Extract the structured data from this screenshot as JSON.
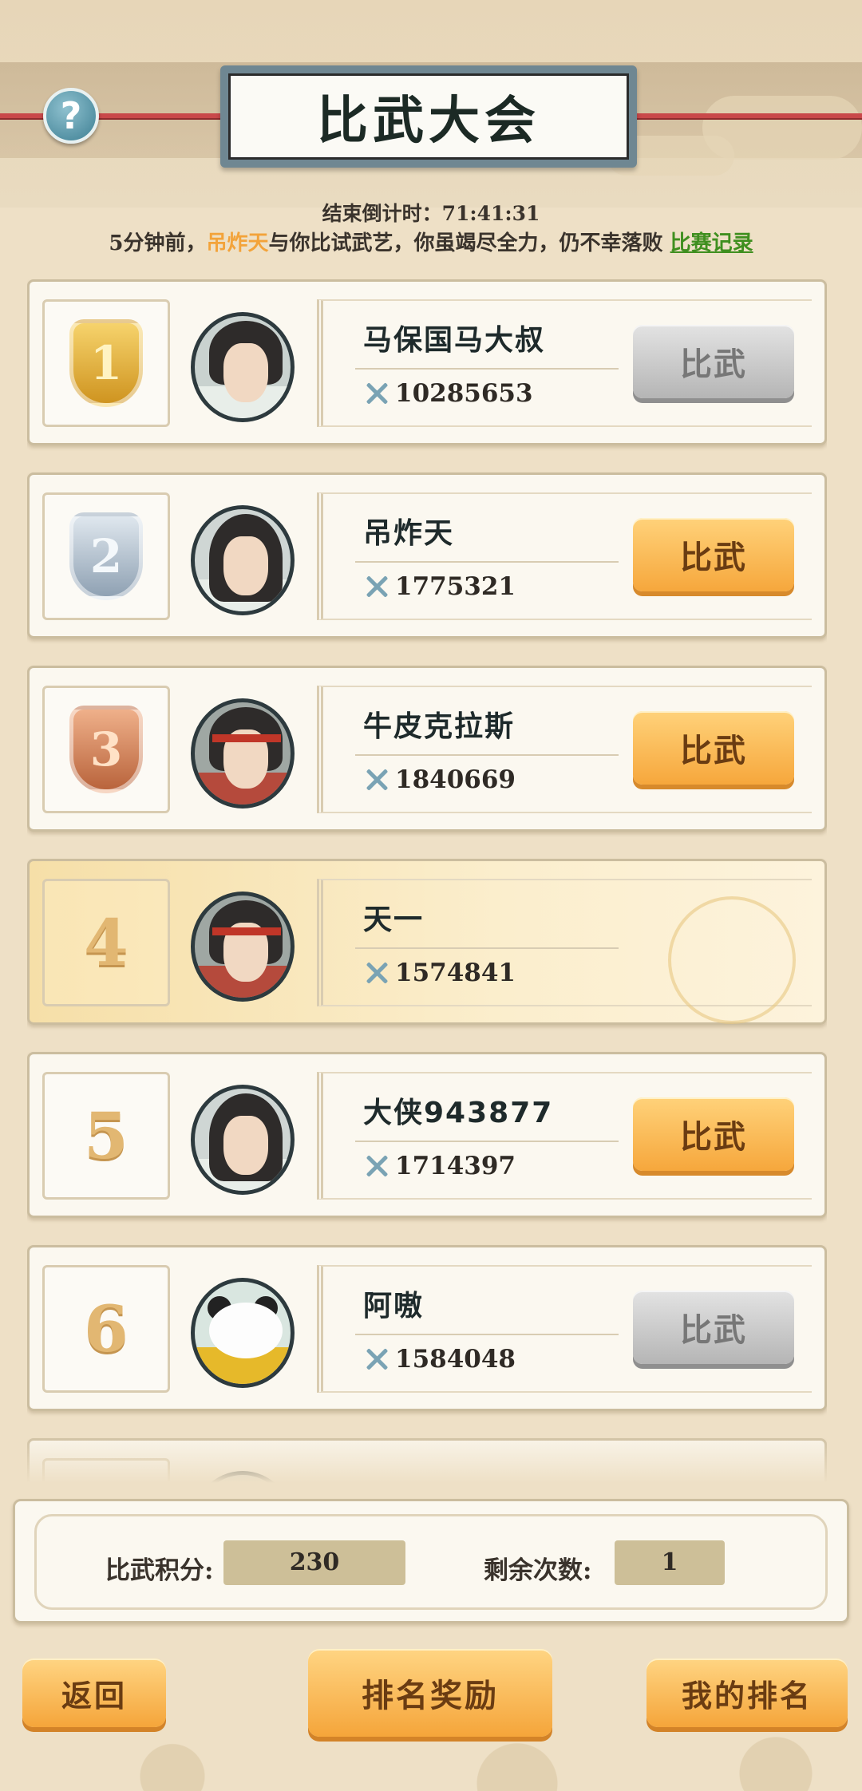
{
  "header": {
    "title": "比武大会",
    "help_symbol": "?"
  },
  "countdown": {
    "label": "结束倒计时：",
    "value": "71:41:31"
  },
  "news": {
    "prefix": "5分钟前，",
    "opponent": "吊炸天",
    "message": "与你比试武艺，你虽竭尽全力，仍不幸落败",
    "record_link": "比赛记录"
  },
  "players": [
    {
      "rank": "1",
      "name": "马保国马大叔",
      "power": "10285653",
      "action": "比武",
      "state": "disabled",
      "badge": "gold",
      "avatar": "scholar"
    },
    {
      "rank": "2",
      "name": "吊炸天",
      "power": "1775321",
      "action": "比武",
      "state": "active",
      "badge": "silver",
      "avatar": "crowned"
    },
    {
      "rank": "3",
      "name": "牛皮克拉斯",
      "power": "1840669",
      "action": "比武",
      "state": "active",
      "badge": "bronze",
      "avatar": "warrior"
    },
    {
      "rank": "4",
      "name": "天一",
      "power": "1574841",
      "action": "",
      "state": "self",
      "badge": "",
      "avatar": "warrior"
    },
    {
      "rank": "5",
      "name": "大侠943877",
      "power": "1714397",
      "action": "比武",
      "state": "active",
      "badge": "",
      "avatar": "crowned"
    },
    {
      "rank": "6",
      "name": "阿嗷",
      "power": "1584048",
      "action": "比武",
      "state": "disabled",
      "badge": "",
      "avatar": "panda"
    }
  ],
  "stats": {
    "score_label": "比武积分:",
    "score_value": "230",
    "remaining_label": "剩余次数:",
    "remaining_value": "1"
  },
  "buttons": {
    "back": "返回",
    "rewards": "排名奖励",
    "my_rank": "我的排名"
  },
  "colors": {
    "accent_orange": "#f6a73c",
    "highlight_name": "#f3a33a",
    "link_green": "#3f8f1f",
    "disabled_gray": "#b5b5b5"
  }
}
